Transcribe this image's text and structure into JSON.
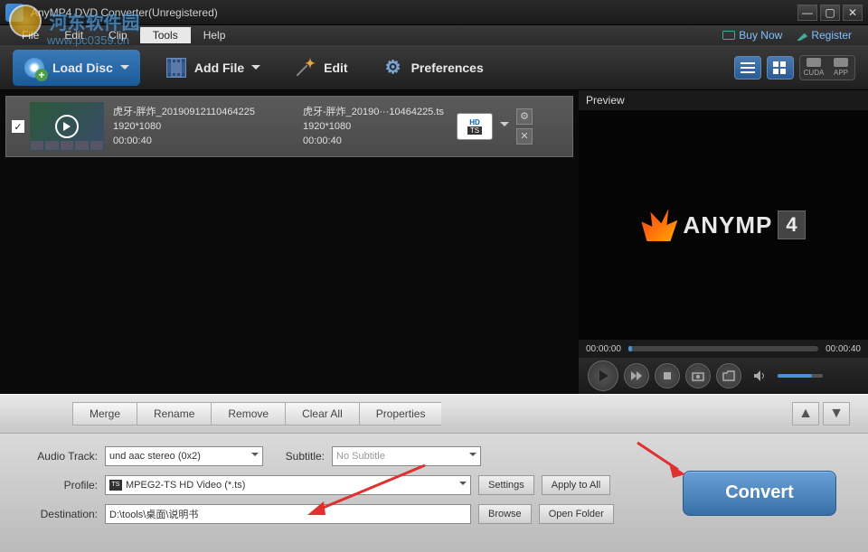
{
  "titlebar": {
    "title": "AnyMP4 DVD Converter(Unregistered)"
  },
  "watermark": {
    "text": "河东软件园",
    "url": "www.pc0359.cn"
  },
  "menubar": {
    "file": "File",
    "edit": "Edit",
    "clip": "Clip",
    "tools": "Tools",
    "help": "Help",
    "buy": "Buy Now",
    "register": "Register"
  },
  "toolbar": {
    "loaddisc": "Load Disc",
    "addfile": "Add File",
    "edit": "Edit",
    "preferences": "Preferences",
    "gpu1": "CUDA",
    "gpu2": "APP"
  },
  "file": {
    "name1": "虎牙-胖炸_20190912110464225",
    "res1": "1920*1080",
    "dur1": "00:00:40",
    "name2": "虎牙-胖炸_20190···10464225.ts",
    "res2": "1920*1080",
    "dur2": "00:00:40",
    "badge_hd": "HD",
    "badge_ts": "TS"
  },
  "preview": {
    "label": "Preview",
    "brand": "ANYMP",
    "brand4": "4",
    "t0": "00:00:00",
    "t1": "00:00:40"
  },
  "actionbar": {
    "merge": "Merge",
    "rename": "Rename",
    "remove": "Remove",
    "clearall": "Clear All",
    "properties": "Properties"
  },
  "form": {
    "audiotrack_label": "Audio Track:",
    "audiotrack": "und aac stereo (0x2)",
    "subtitle_label": "Subtitle:",
    "subtitle": "No Subtitle",
    "profile_label": "Profile:",
    "profile": "MPEG2-TS HD Video (*.ts)",
    "dest_label": "Destination:",
    "dest": "D:\\tools\\桌面\\说明书",
    "settings": "Settings",
    "applyall": "Apply to All",
    "browse": "Browse",
    "openfolder": "Open Folder",
    "convert": "Convert"
  }
}
